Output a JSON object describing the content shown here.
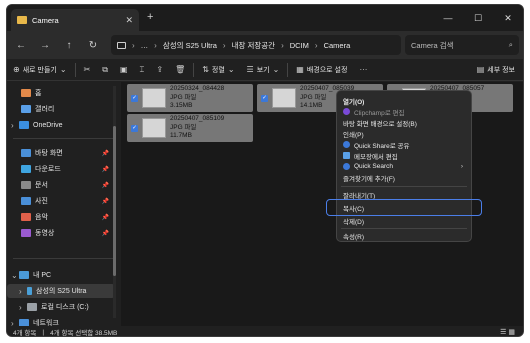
{
  "window": {
    "tab_title": "Camera",
    "new_tab": "+",
    "controls": {
      "minimize": "—",
      "maximize": "☐",
      "close": "✕"
    }
  },
  "nav": {
    "back": "←",
    "forward": "→",
    "up": "↑",
    "refresh": "↻"
  },
  "address": {
    "crumbs": [
      "…",
      "삼성의 S25 Ultra",
      "내장 저장공간",
      "DCIM",
      "Camera"
    ],
    "separator": "›"
  },
  "search": {
    "placeholder": "Camera 검색",
    "icon": "search-icon"
  },
  "commandbar": {
    "new_label": "새로 만들기",
    "sort_label": "정렬",
    "view_label": "보기",
    "wallpaper_label": "배경으로 설정",
    "details_label": "세부 정보"
  },
  "sidebar": {
    "items": [
      {
        "label": "홈",
        "color": "#e38a4a"
      },
      {
        "label": "갤러리",
        "color": "#5aa0e8"
      },
      {
        "label": "OneDrive",
        "color": "#3b8fe0"
      },
      {
        "label": "바탕 화면",
        "color": "#4a90d9"
      },
      {
        "label": "다운로드",
        "color": "#3fa5e0"
      },
      {
        "label": "문서",
        "color": "#8a8a8a"
      },
      {
        "label": "사진",
        "color": "#4a8fd8"
      },
      {
        "label": "음악",
        "color": "#e0604a"
      },
      {
        "label": "동영상",
        "color": "#9a5ad0"
      },
      {
        "label": "내 PC",
        "color": "#4a9ad8"
      },
      {
        "label": "삼성의 S25 Ultra",
        "color": "#4aa0d8"
      },
      {
        "label": "로컬 디스크 (C:)",
        "color": "#9aa0a6"
      },
      {
        "label": "네트워크",
        "color": "#4a90d9"
      }
    ]
  },
  "files": [
    {
      "name": "20250324_084428",
      "type": "JPG 파일",
      "size": "3.15MB"
    },
    {
      "name": "20250407_085039",
      "type": "JPG 파일",
      "size": "14.1MB"
    },
    {
      "name": "20250407_085057",
      "type": "JPG 파일",
      "size": "6.7MB"
    },
    {
      "name": "20250407_085109",
      "type": "JPG 파일",
      "size": "11.7MB"
    }
  ],
  "context_menu": {
    "items": [
      {
        "label": "열기(O)",
        "icon": ""
      },
      {
        "label": "Clipchamp로 편집",
        "icon": "clipchamp-icon",
        "color": "#7a4ad8"
      },
      {
        "label": "바탕 화면 배경으로 설정(B)",
        "icon": ""
      },
      {
        "label": "인쇄(P)",
        "icon": ""
      },
      {
        "label": "Quick Share로 공유",
        "icon": "quickshare-icon",
        "color": "#3b78d8"
      },
      {
        "label": "메모장에서 편집",
        "icon": "notepad-icon",
        "color": "#5aa0e8"
      },
      {
        "label": "Quick Search",
        "icon": "quicksearch-icon",
        "color": "#3b78d8"
      },
      {
        "label": "즐겨찾기에 추가(F)",
        "icon": ""
      },
      {
        "label": "잘라내기(T)",
        "icon": ""
      },
      {
        "label": "복사(C)",
        "icon": ""
      },
      {
        "label": "삭제(D)",
        "icon": ""
      },
      {
        "label": "속성(R)",
        "icon": ""
      }
    ],
    "submenu_arrow": "›"
  },
  "status": {
    "item_count": "4개 항목",
    "selection": "4개 항목 선택함 38.5MB"
  }
}
